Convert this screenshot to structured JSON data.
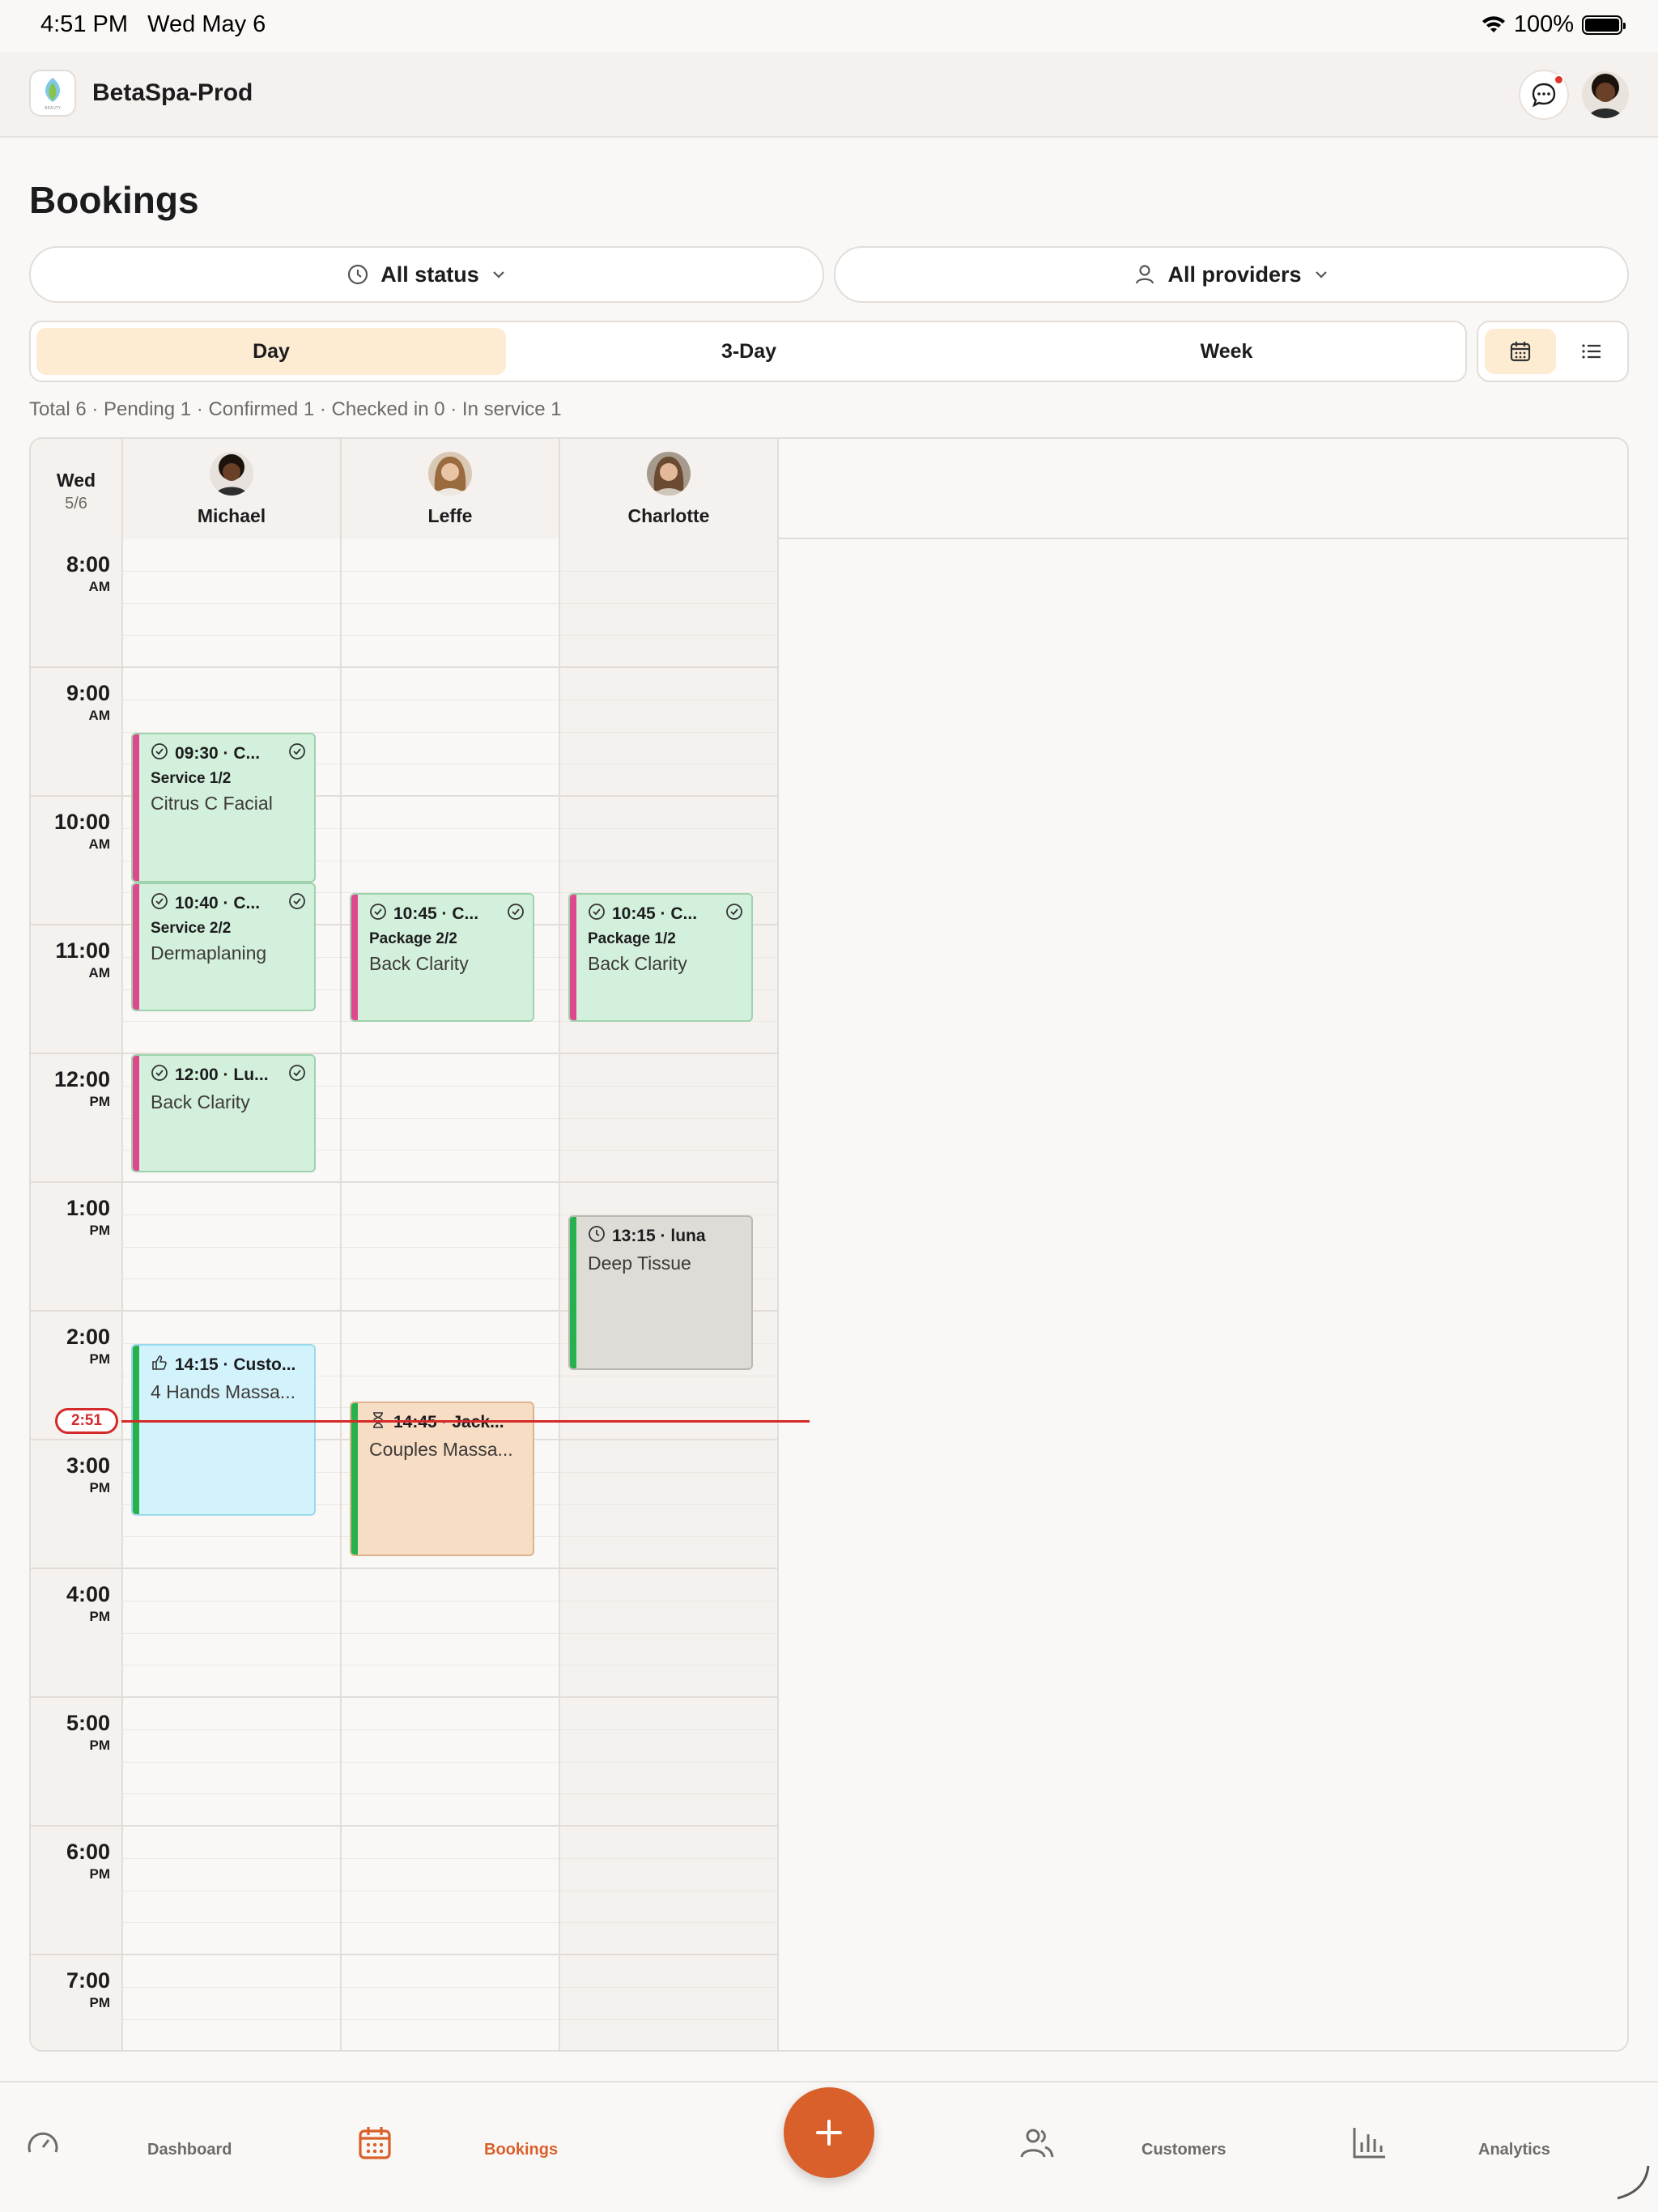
{
  "status_bar": {
    "time": "4:51 PM",
    "date": "Wed May 6",
    "battery": "100%"
  },
  "app": {
    "name": "BetaSpa-Prod",
    "logo_caption": "BEAUTY",
    "has_unread_messages": true
  },
  "page": {
    "title": "Bookings"
  },
  "filters": {
    "status": "All status",
    "providers": "All providers"
  },
  "view_modes": [
    "Day",
    "3-Day",
    "Week"
  ],
  "active_view_mode": "Day",
  "layout_toggle": {
    "options": [
      "calendar-icon",
      "list-icon"
    ],
    "active": "calendar-icon"
  },
  "summary": "Total 6 · Pending 1 · Confirmed 1 · Checked in 0 · In service 1",
  "calendar": {
    "day_label": "Wed",
    "date_label": "5/6",
    "hours": [
      {
        "time": "8:00",
        "ampm": "AM"
      },
      {
        "time": "9:00",
        "ampm": "AM"
      },
      {
        "time": "10:00",
        "ampm": "AM"
      },
      {
        "time": "11:00",
        "ampm": "AM"
      },
      {
        "time": "12:00",
        "ampm": "PM"
      },
      {
        "time": "1:00",
        "ampm": "PM"
      },
      {
        "time": "2:00",
        "ampm": "PM"
      },
      {
        "time": "3:00",
        "ampm": "PM"
      },
      {
        "time": "4:00",
        "ampm": "PM"
      },
      {
        "time": "5:00",
        "ampm": "PM"
      },
      {
        "time": "6:00",
        "ampm": "PM"
      },
      {
        "time": "7:00",
        "ampm": "PM"
      }
    ],
    "providers": [
      "Michael",
      "Leffe",
      "Charlotte"
    ],
    "current_time": "2:51",
    "bookings": [
      {
        "provider": "Michael",
        "start": "09:30",
        "end": "10:40",
        "title": "09:30 · C...",
        "tag": "Service 1/2",
        "service": "Citrus C Facial",
        "status_icon": "check-circle-icon",
        "color": "green",
        "accent": "pink",
        "confirmed_mark": true
      },
      {
        "provider": "Michael",
        "start": "10:40",
        "end": "11:40",
        "title": "10:40 · C...",
        "tag": "Service 2/2",
        "service": "Dermaplaning",
        "status_icon": "check-circle-icon",
        "color": "green",
        "accent": "pink",
        "confirmed_mark": true
      },
      {
        "provider": "Leffe",
        "start": "10:45",
        "end": "11:45",
        "title": "10:45 · C...",
        "tag": "Package 2/2",
        "service": "Back Clarity",
        "status_icon": "check-circle-icon",
        "color": "green",
        "accent": "pink",
        "confirmed_mark": true
      },
      {
        "provider": "Charlotte",
        "start": "10:45",
        "end": "11:45",
        "title": "10:45 · C...",
        "tag": "Package 1/2",
        "service": "Back Clarity",
        "status_icon": "check-circle-icon",
        "color": "green",
        "accent": "pink",
        "confirmed_mark": true
      },
      {
        "provider": "Michael",
        "start": "12:00",
        "end": "12:55",
        "title": "12:00 · Lu...",
        "tag": "",
        "service": "Back Clarity",
        "status_icon": "check-circle-icon",
        "color": "green",
        "accent": "pink",
        "confirmed_mark": true
      },
      {
        "provider": "Charlotte",
        "start": "13:15",
        "end": "14:27",
        "title": "13:15 · luna",
        "tag": "",
        "service": "Deep Tissue",
        "status_icon": "clock-icon",
        "color": "gray",
        "accent": "green",
        "confirmed_mark": false
      },
      {
        "provider": "Michael",
        "start": "14:15",
        "end": "15:35",
        "title": "14:15 · Custo...",
        "tag": "",
        "service": "4 Hands Massa...",
        "status_icon": "thumbs-up-icon",
        "color": "blue",
        "accent": "green",
        "confirmed_mark": false
      },
      {
        "provider": "Leffe",
        "start": "14:42",
        "end": "15:54",
        "title": "14:45 · Jack...",
        "tag": "",
        "service": "Couples Massa...",
        "status_icon": "hourglass-icon",
        "color": "orange",
        "accent": "green",
        "confirmed_mark": false
      }
    ]
  },
  "tabbar": {
    "items": [
      {
        "label": "Dashboard",
        "icon": "gauge-icon",
        "active": false
      },
      {
        "label": "Bookings",
        "icon": "calendar-icon",
        "active": true
      },
      {
        "label": "Customers",
        "icon": "users-icon",
        "active": false
      },
      {
        "label": "Analytics",
        "icon": "bar-chart-icon",
        "active": false
      }
    ],
    "fab_icon": "plus-icon"
  },
  "colors": {
    "accent": "#d9602a",
    "active_segment": "#fdebd2",
    "now_line": "#d42a2a",
    "event_green": "#d3f0dc",
    "event_gray": "#dfdcd7",
    "event_blue": "#d2f3fb",
    "event_orange": "#f8ddc5",
    "accent_pink": "#e0488e",
    "accent_green": "#27b14d"
  }
}
